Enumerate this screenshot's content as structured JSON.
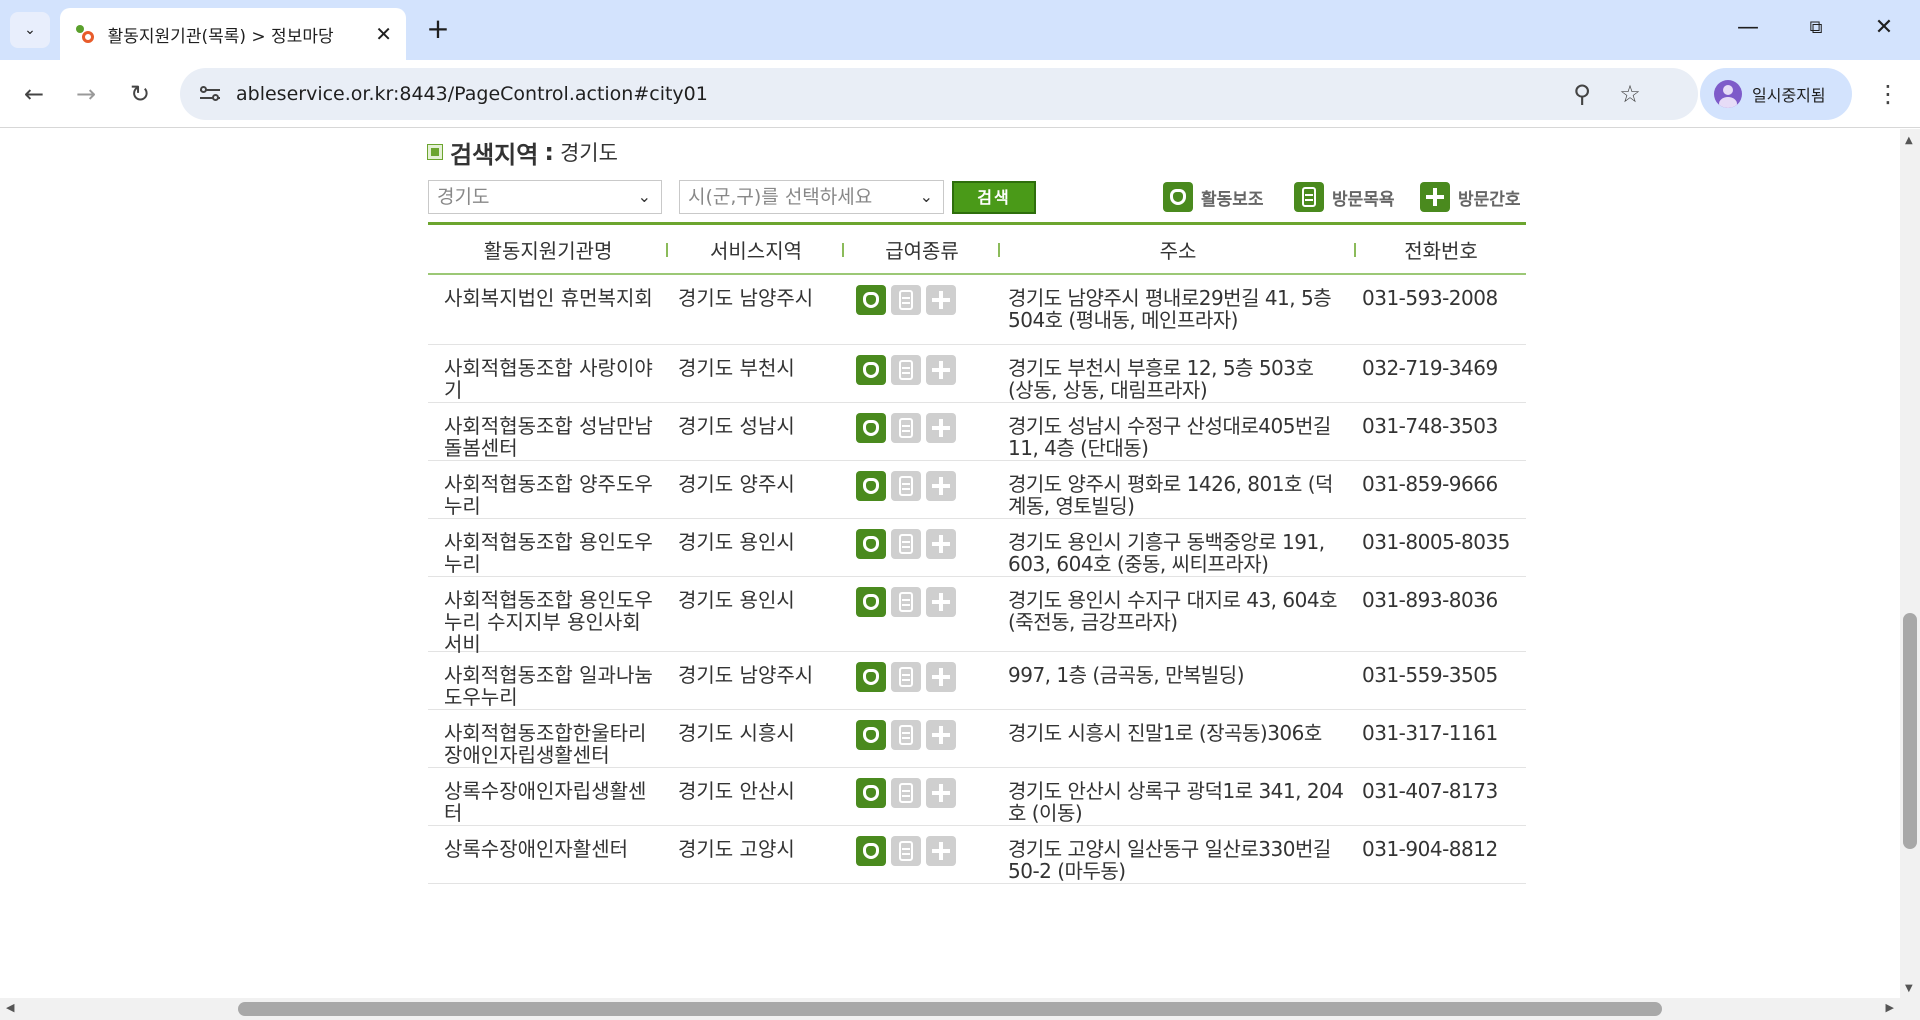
{
  "browser": {
    "tab_title": "활동지원기관(목록) > 정보마당",
    "url": "ableservice.or.kr:8443/PageControl.action#city01",
    "profile_label": "일시중지됨"
  },
  "page": {
    "region_label": "검색지역",
    "region_colon": ":",
    "region_value": "경기도",
    "province_select": "경기도",
    "city_placeholder": "시(군,구)를 선택하세요",
    "search_button": "검색",
    "legend": [
      {
        "label": "활동보조",
        "icon": "leaf-icon"
      },
      {
        "label": "방문목욕",
        "icon": "bath-icon"
      },
      {
        "label": "방문간호",
        "icon": "plus-icon"
      }
    ],
    "columns": [
      "활동지원기관명",
      "서비스지역",
      "급여종류",
      "주소",
      "전화번호"
    ],
    "rows": [
      {
        "name": "사회복지법인 휴먼복지회",
        "area": "경기도 남양주시",
        "address": "경기도 남양주시 평내로29번길 41, 5층 504호 (평내동, 메인프라자)",
        "phone": "031-593-2008"
      },
      {
        "name": "사회적협동조합 사랑이야기",
        "area": "경기도 부천시",
        "address": "경기도 부천시 부흥로 12, 5층 503호 (상동, 상동, 대림프라자)",
        "phone": "032-719-3469"
      },
      {
        "name": "사회적협동조합 성남만남돌봄센터",
        "area": "경기도 성남시",
        "address": "경기도 성남시 수정구 산성대로405번길 11, 4층 (단대동)",
        "phone": "031-748-3503"
      },
      {
        "name": "사회적협동조합 양주도우누리",
        "area": "경기도 양주시",
        "address": "경기도 양주시 평화로 1426, 801호 (덕계동, 영토빌딩)",
        "phone": "031-859-9666"
      },
      {
        "name": "사회적협동조합 용인도우누리",
        "area": "경기도 용인시",
        "address": "경기도 용인시 기흥구 동백중앙로 191, 603, 604호 (중동, 씨티프라자)",
        "phone": "031-8005-8035"
      },
      {
        "name": "사회적협동조합 용인도우누리 수지지부 용인사회서비",
        "area": "경기도 용인시",
        "address": "경기도 용인시 수지구 대지로 43, 604호 (죽전동, 금강프라자)",
        "phone": "031-893-8036"
      },
      {
        "name": "사회적협동조합 일과나눔 도우누리",
        "area": "경기도 남양주시",
        "address": "997, 1층 (금곡동, 만복빌딩)",
        "phone": "031-559-3505"
      },
      {
        "name": "사회적협동조합한울타리장애인자립생활센터",
        "area": "경기도 시흥시",
        "address": "경기도 시흥시 진말1로 (장곡동)306호",
        "phone": "031-317-1161"
      },
      {
        "name": "상록수장애인자립생활센터",
        "area": "경기도 안산시",
        "address": "경기도 안산시 상록구 광덕1로 341, 204호 (이동)",
        "phone": "031-407-8173"
      },
      {
        "name": "상록수장애인자활센터",
        "area": "경기도 고양시",
        "address": "경기도 고양시 일산동구 일산로330번길 50-2 (마두동)",
        "phone": "031-904-8812"
      }
    ]
  },
  "colors": {
    "accent_green": "#4a8a1e",
    "line_green": "#6ca52f",
    "chrome_blue": "#d3e3fd"
  }
}
